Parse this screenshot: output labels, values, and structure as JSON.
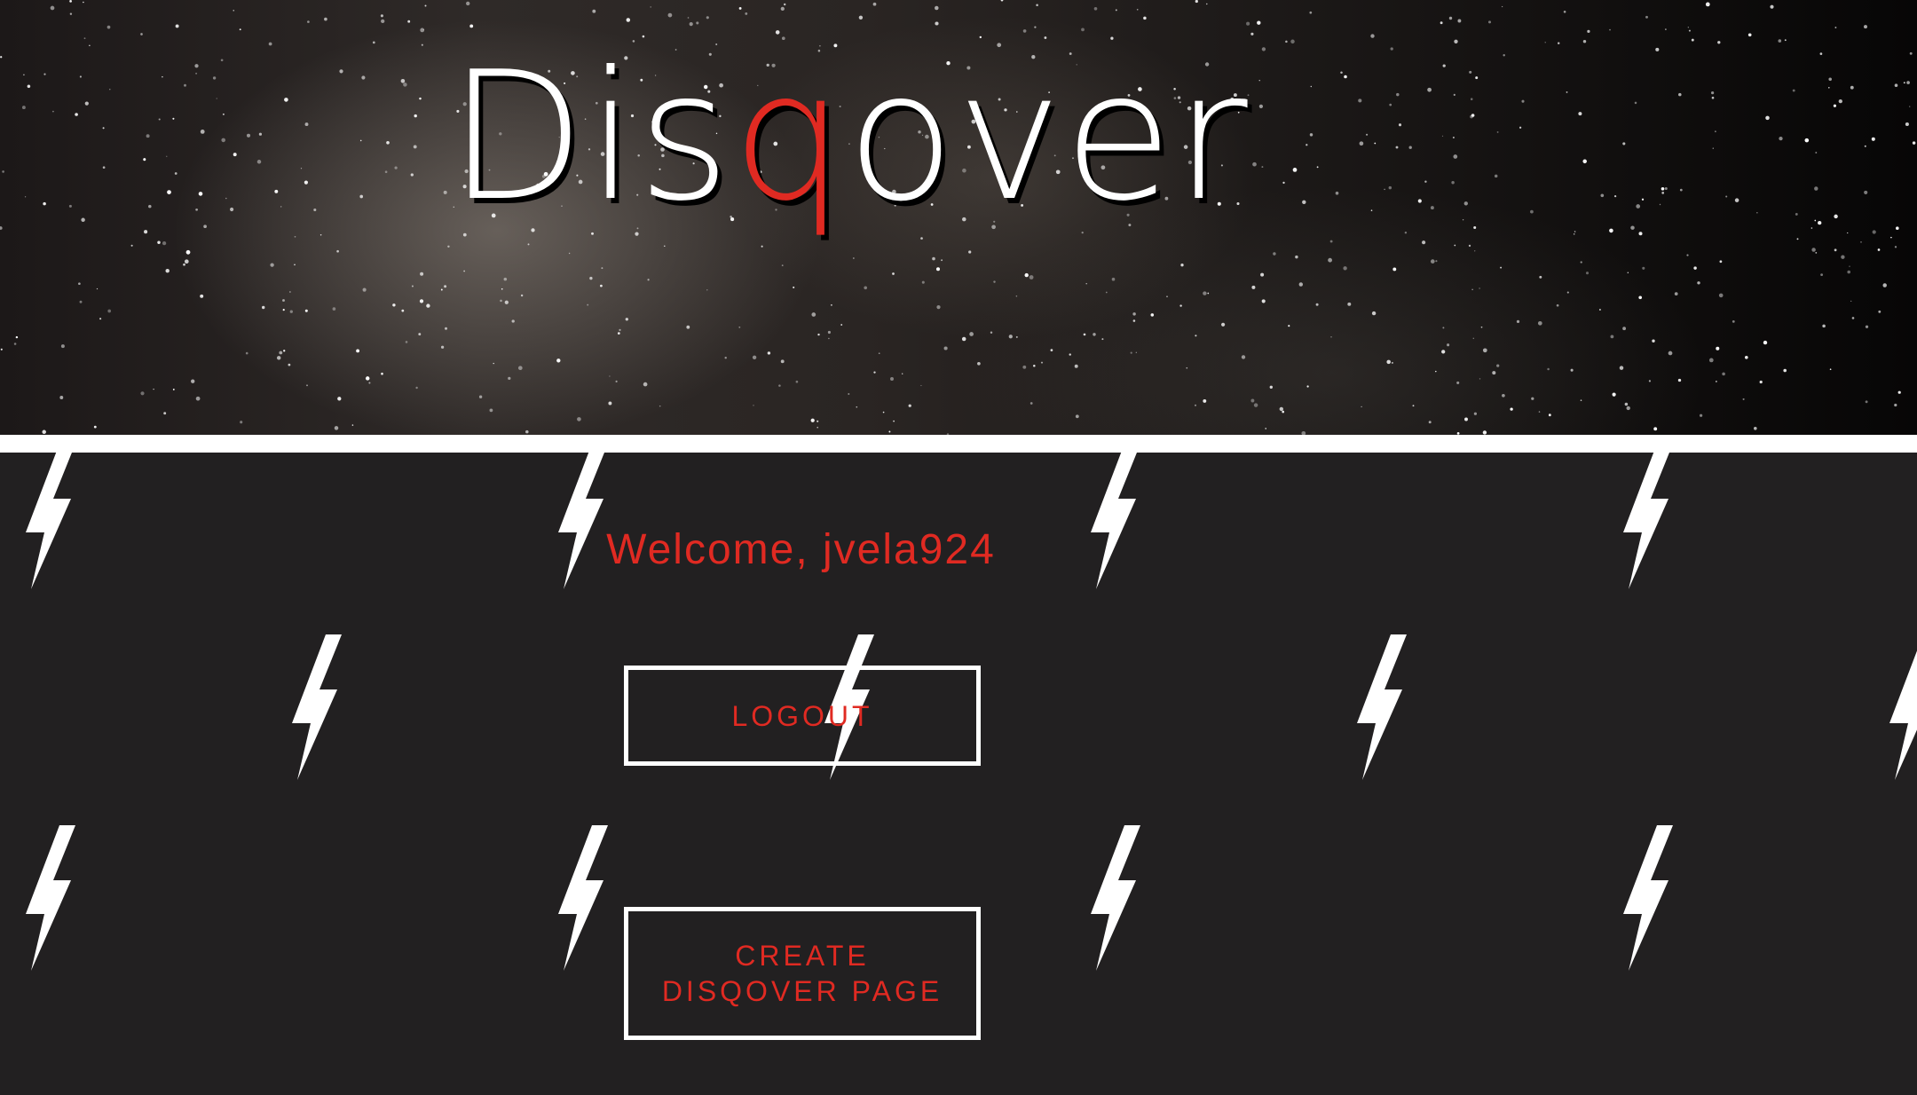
{
  "header": {
    "logo_part1": "Dis",
    "logo_accent": "q",
    "logo_part2": "over",
    "accent_color": "#e02a22",
    "background_image": "starry night sky"
  },
  "main": {
    "welcome_text": "Welcome, jvela924",
    "logout_label": "LOGOUT",
    "create_label_line1": "CREATE",
    "create_label_line2": "DISQOVER PAGE",
    "background_pattern": "lightning-bolt-icon",
    "background_color": "#222021",
    "text_color": "#e02a22"
  }
}
